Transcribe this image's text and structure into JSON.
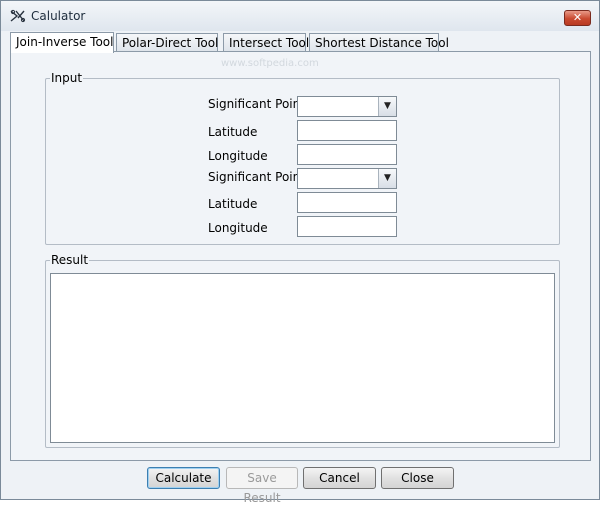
{
  "window": {
    "title": "Calulator",
    "close_label": "✕"
  },
  "tabs": [
    {
      "label": "Join-Inverse Tool",
      "active": true
    },
    {
      "label": "Polar-Direct Tool",
      "active": false
    },
    {
      "label": "Intersect Tool",
      "active": false
    },
    {
      "label": "Shortest Distance Tool",
      "active": false
    }
  ],
  "watermark": "www.softpedia.com",
  "input_group": {
    "legend": "Input",
    "point1": {
      "label": "Significant Point",
      "value": ""
    },
    "latitude1": {
      "label": "Latitude",
      "value": ""
    },
    "longitude1": {
      "label": "Longitude",
      "value": ""
    },
    "point2": {
      "label": "Significant Point",
      "value": ""
    },
    "latitude2": {
      "label": "Latitude",
      "value": ""
    },
    "longitude2": {
      "label": "Longitude",
      "value": ""
    }
  },
  "result_group": {
    "legend": "Result",
    "text": ""
  },
  "buttons": {
    "calculate": "Calculate",
    "save_result": "Save Result",
    "cancel": "Cancel",
    "close": "Close"
  },
  "colors": {
    "window_bg": "#eef2f6",
    "panel_bg": "#f1f4f8",
    "close_button": "#c94a30"
  }
}
